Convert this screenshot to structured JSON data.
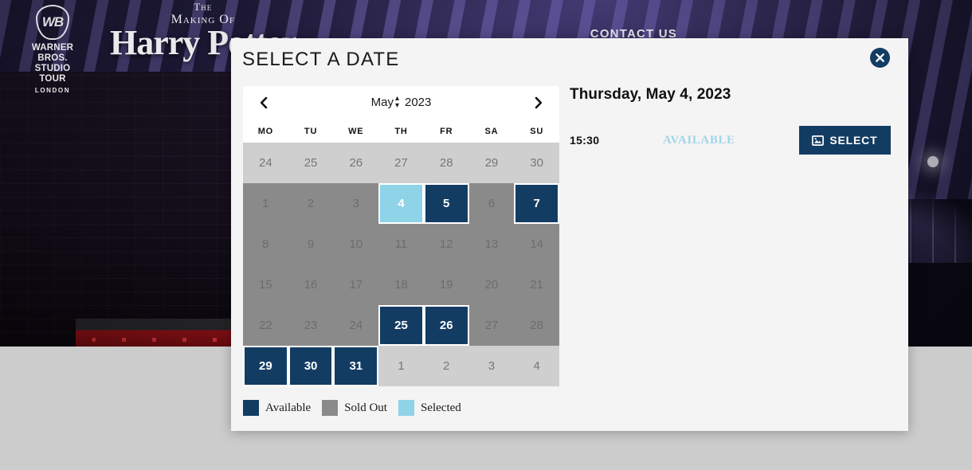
{
  "site": {
    "logo": {
      "shield_text": "WB",
      "line1": "WARNER BROS.",
      "line2": "STUDIO TOUR",
      "line3": "LONDON"
    },
    "title_logo": {
      "line1": "The",
      "line2": "Making Of",
      "line3": "Harry Potter"
    },
    "nav": {
      "contact": "CONTACT US"
    }
  },
  "modal": {
    "title": "SELECT A DATE",
    "close_label": "Close"
  },
  "calendar": {
    "prev_label": "Previous month",
    "next_label": "Next month",
    "month": "May",
    "year": "2023",
    "weekdays": [
      "MO",
      "TU",
      "WE",
      "TH",
      "FR",
      "SA",
      "SU"
    ],
    "days": [
      {
        "n": "24",
        "state": "out"
      },
      {
        "n": "25",
        "state": "out"
      },
      {
        "n": "26",
        "state": "out"
      },
      {
        "n": "27",
        "state": "out"
      },
      {
        "n": "28",
        "state": "out"
      },
      {
        "n": "29",
        "state": "out"
      },
      {
        "n": "30",
        "state": "out"
      },
      {
        "n": "1",
        "state": "soldout"
      },
      {
        "n": "2",
        "state": "soldout"
      },
      {
        "n": "3",
        "state": "soldout"
      },
      {
        "n": "4",
        "state": "selected"
      },
      {
        "n": "5",
        "state": "available"
      },
      {
        "n": "6",
        "state": "soldout"
      },
      {
        "n": "7",
        "state": "available"
      },
      {
        "n": "8",
        "state": "soldout"
      },
      {
        "n": "9",
        "state": "soldout"
      },
      {
        "n": "10",
        "state": "soldout"
      },
      {
        "n": "11",
        "state": "soldout"
      },
      {
        "n": "12",
        "state": "soldout"
      },
      {
        "n": "13",
        "state": "soldout"
      },
      {
        "n": "14",
        "state": "soldout"
      },
      {
        "n": "15",
        "state": "soldout"
      },
      {
        "n": "16",
        "state": "soldout"
      },
      {
        "n": "17",
        "state": "soldout"
      },
      {
        "n": "18",
        "state": "soldout"
      },
      {
        "n": "19",
        "state": "soldout"
      },
      {
        "n": "20",
        "state": "soldout"
      },
      {
        "n": "21",
        "state": "soldout"
      },
      {
        "n": "22",
        "state": "soldout"
      },
      {
        "n": "23",
        "state": "soldout"
      },
      {
        "n": "24",
        "state": "soldout"
      },
      {
        "n": "25",
        "state": "available"
      },
      {
        "n": "26",
        "state": "available"
      },
      {
        "n": "27",
        "state": "soldout"
      },
      {
        "n": "28",
        "state": "soldout"
      },
      {
        "n": "29",
        "state": "available"
      },
      {
        "n": "30",
        "state": "available"
      },
      {
        "n": "31",
        "state": "available"
      },
      {
        "n": "1",
        "state": "out"
      },
      {
        "n": "2",
        "state": "out"
      },
      {
        "n": "3",
        "state": "out"
      },
      {
        "n": "4",
        "state": "out"
      }
    ]
  },
  "legend": [
    {
      "label": "Available",
      "color": "#133c63"
    },
    {
      "label": "Sold Out",
      "color": "#8a8a8a"
    },
    {
      "label": "Selected",
      "color": "#8ed3e8"
    }
  ],
  "detail": {
    "date": "Thursday, May 4, 2023",
    "slot": {
      "time": "15:30",
      "status": "AVAILABLE",
      "select_label": "SELECT"
    }
  },
  "colors": {
    "accent_navy": "#133c63",
    "selected_blue": "#8ed3e8",
    "soldout_gray": "#8a8a8a",
    "outmonth_gray": "#cfcfcf",
    "modal_bg": "#f4f4f4"
  }
}
